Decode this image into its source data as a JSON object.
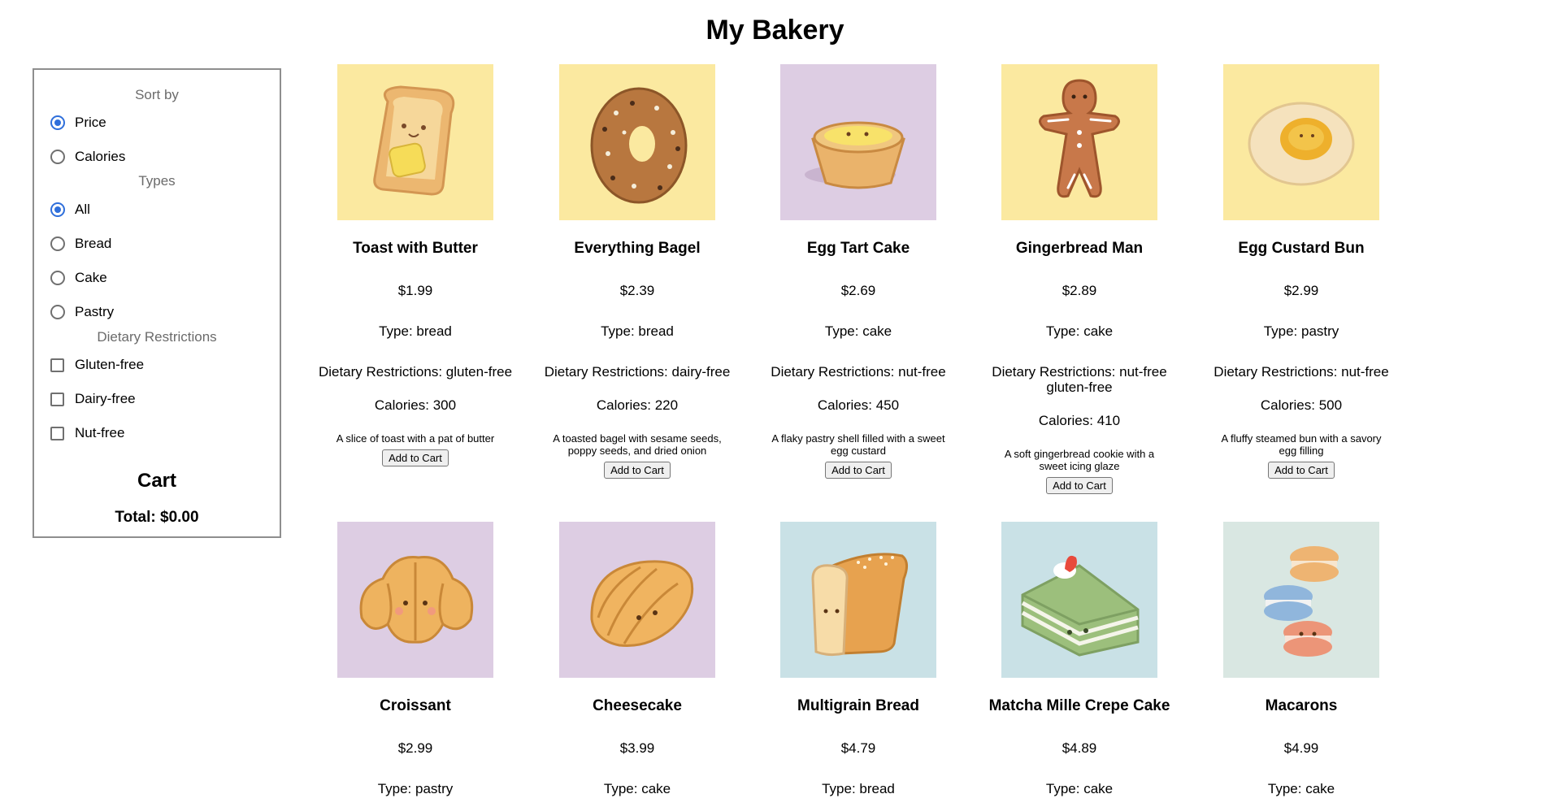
{
  "title": "My Bakery",
  "sidebar": {
    "sort_title": "Sort by",
    "sort_options": [
      {
        "label": "Price",
        "checked": true
      },
      {
        "label": "Calories",
        "checked": false
      }
    ],
    "types_title": "Types",
    "type_options": [
      {
        "label": "All",
        "checked": true
      },
      {
        "label": "Bread",
        "checked": false
      },
      {
        "label": "Cake",
        "checked": false
      },
      {
        "label": "Pastry",
        "checked": false
      }
    ],
    "diet_title": "Dietary Restrictions",
    "diet_options": [
      {
        "label": "Gluten-free",
        "checked": false
      },
      {
        "label": "Dairy-free",
        "checked": false
      },
      {
        "label": "Nut-free",
        "checked": false
      }
    ],
    "cart_title": "Cart",
    "cart_total": "Total: $0.00"
  },
  "products": [
    {
      "name": "Toast with Butter",
      "price": "$1.99",
      "type": "Type: bread",
      "diet": "Dietary Restrictions: gluten-free",
      "calories": "Calories: 300",
      "description": "A slice of toast with a pat of butter",
      "button": "Add to Cart",
      "bg": "#fbe9a0",
      "icon": "toast-icon"
    },
    {
      "name": "Everything Bagel",
      "price": "$2.39",
      "type": "Type: bread",
      "diet": "Dietary Restrictions: dairy-free",
      "calories": "Calories: 220",
      "description": "A toasted bagel with sesame seeds, poppy seeds, and dried onion",
      "button": "Add to Cart",
      "bg": "#fbe9a0",
      "icon": "bagel-icon"
    },
    {
      "name": "Egg Tart Cake",
      "price": "$2.69",
      "type": "Type: cake",
      "diet": "Dietary Restrictions: nut-free",
      "calories": "Calories: 450",
      "description": "A flaky pastry shell filled with a sweet egg custard",
      "button": "Add to Cart",
      "bg": "#ddcde3",
      "icon": "egg-tart-icon"
    },
    {
      "name": "Gingerbread Man",
      "price": "$2.89",
      "type": "Type: cake",
      "diet": "Dietary Restrictions: nut-free gluten-free",
      "calories": "Calories: 410",
      "description": "A soft gingerbread cookie with a sweet icing glaze",
      "button": "Add to Cart",
      "bg": "#fbe9a0",
      "icon": "gingerbread-icon"
    },
    {
      "name": "Egg Custard Bun",
      "price": "$2.99",
      "type": "Type: pastry",
      "diet": "Dietary Restrictions: nut-free",
      "calories": "Calories: 500",
      "description": "A fluffy steamed bun with a savory egg filling",
      "button": "Add to Cart",
      "bg": "#fbe9a0",
      "icon": "custard-bun-icon"
    },
    {
      "name": "Croissant",
      "price": "$2.99",
      "type": "Type: pastry",
      "bg": "#ddcde3",
      "icon": "croissant-icon"
    },
    {
      "name": "Cheesecake",
      "price": "$3.99",
      "type": "Type: cake",
      "bg": "#ddcde3",
      "icon": "cheesecake-icon"
    },
    {
      "name": "Multigrain Bread",
      "price": "$4.79",
      "type": "Type: bread",
      "bg": "#c9e1e6",
      "icon": "bread-loaf-icon"
    },
    {
      "name": "Matcha Mille Crepe Cake",
      "price": "$4.89",
      "type": "Type: cake",
      "bg": "#c9e1e6",
      "icon": "crepe-cake-icon"
    },
    {
      "name": "Macarons",
      "price": "$4.99",
      "type": "Type: cake",
      "bg": "#d9e7e2",
      "icon": "macarons-icon"
    }
  ]
}
